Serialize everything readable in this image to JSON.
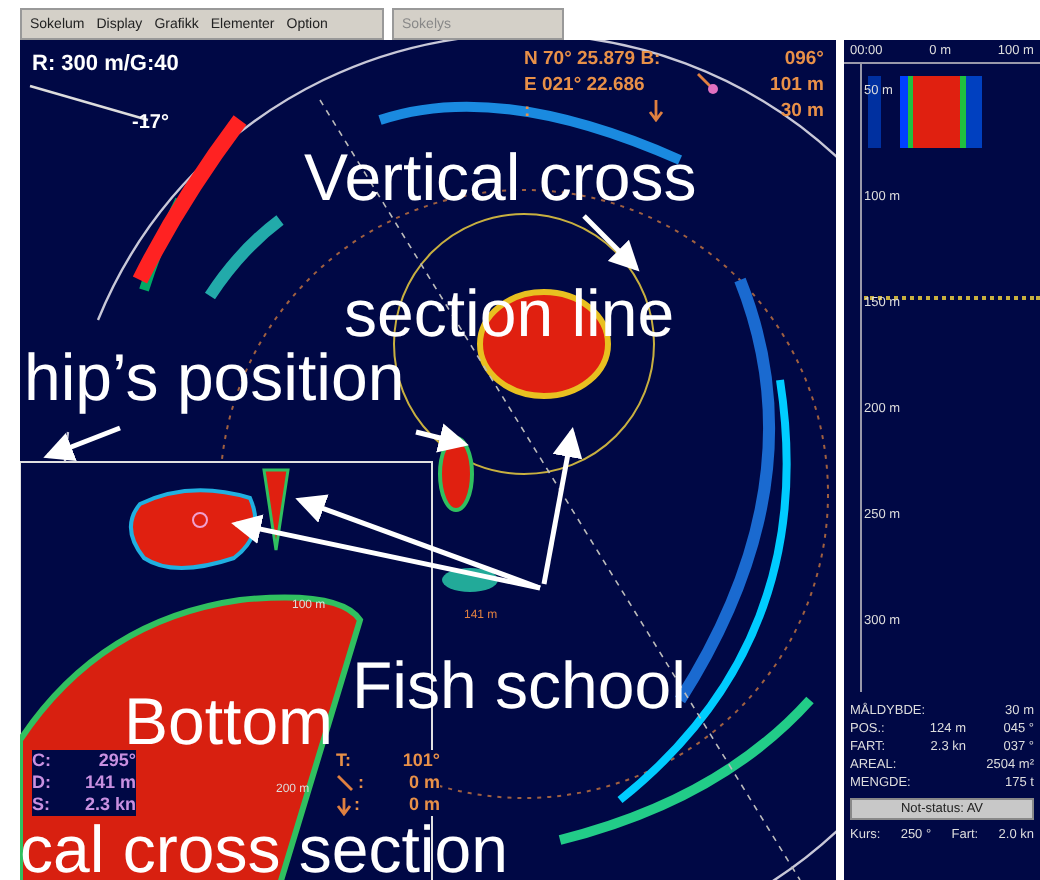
{
  "menu": [
    "Sokelum",
    "Display",
    "Grafikk",
    "Elementer",
    "Option"
  ],
  "side_box": "Sokelys",
  "sonar": {
    "range": "R: 300 m/G:40",
    "tilt": "-17°",
    "position": [
      {
        "kind": "text",
        "label": "N 70° 25.879 B:",
        "value": "096°"
      },
      {
        "kind": "distance",
        "label": "E 021° 22.686",
        "value": "101 m"
      },
      {
        "kind": "depth",
        "label": ":",
        "value": "30 m"
      }
    ],
    "readouts_left": [
      {
        "label": "C:",
        "value": "295°"
      },
      {
        "label": "D:",
        "value": "141 m"
      },
      {
        "label": "S:",
        "value": "2.3 kn"
      }
    ],
    "readouts_right": [
      {
        "kind": "text",
        "label": "T:",
        "value": "101°"
      },
      {
        "kind": "distance",
        "label": ":",
        "value": "0 m"
      },
      {
        "kind": "depth",
        "label": ":",
        "value": "0 m"
      }
    ],
    "inset_labels": [
      "100 m",
      "200 m"
    ],
    "target_label": "141 m"
  },
  "annotations": [
    "Vertical cross",
    "section line",
    "hip’s position",
    "Bottom",
    "Fish school",
    "cal cross section"
  ],
  "side_panel": {
    "header": [
      "00:00",
      "0 m",
      "100 m"
    ],
    "depths": [
      "50 m",
      "100 m",
      "150 m",
      "200 m",
      "250 m",
      "300 m"
    ],
    "info": [
      {
        "label": "MÅLDYBDE:",
        "value_2": "30 m"
      },
      {
        "label": "POS.:",
        "value_1": "124 m",
        "value_2": "045 °"
      },
      {
        "label": "FART:",
        "value_1": "2.3 kn",
        "value_2": "037 °"
      },
      {
        "label": "AREAL:",
        "value_2": "2504 m²"
      },
      {
        "label": "MENGDE:",
        "value_2": "175 t"
      }
    ],
    "status_button": "Not-status: AV",
    "footer": [
      "Kurs:",
      "250 °",
      "Fart:",
      "2.0 kn"
    ]
  }
}
